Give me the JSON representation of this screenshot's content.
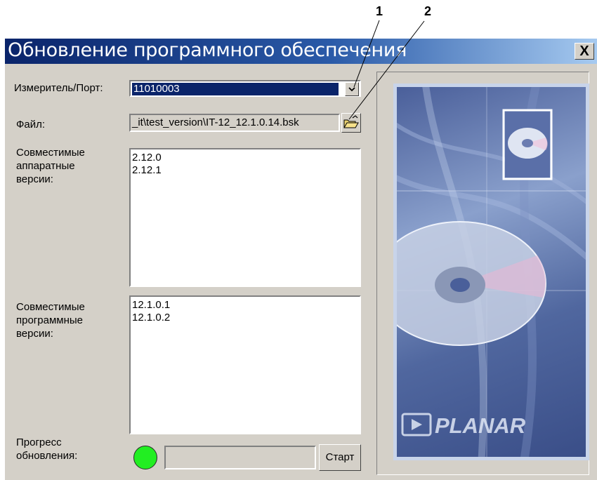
{
  "callouts": [
    "1",
    "2"
  ],
  "window": {
    "title": "Обновление программного обеспечения",
    "close_label": "X"
  },
  "labels": {
    "meter_port": "Измеритель/Порт:",
    "file": "Файл:",
    "hw_versions": "Совместимые аппаратные версии:",
    "sw_versions": "Совместимые программные версии:",
    "progress": "Прогресс обновления:"
  },
  "meter_port_value": "11010003",
  "file_path": "_it\\test_version\\IT-12_12.1.0.14.bsk",
  "hw_versions": [
    "2.12.0",
    "2.12.1"
  ],
  "sw_versions": [
    "12.1.0.1",
    "12.1.0.2"
  ],
  "start_label": "Старт",
  "brand": "PLANAR",
  "colors": {
    "title_start": "#0a246a",
    "title_end": "#a6caf0",
    "indicator": "#22ee22",
    "dialog_bg": "#d4d0c8"
  }
}
